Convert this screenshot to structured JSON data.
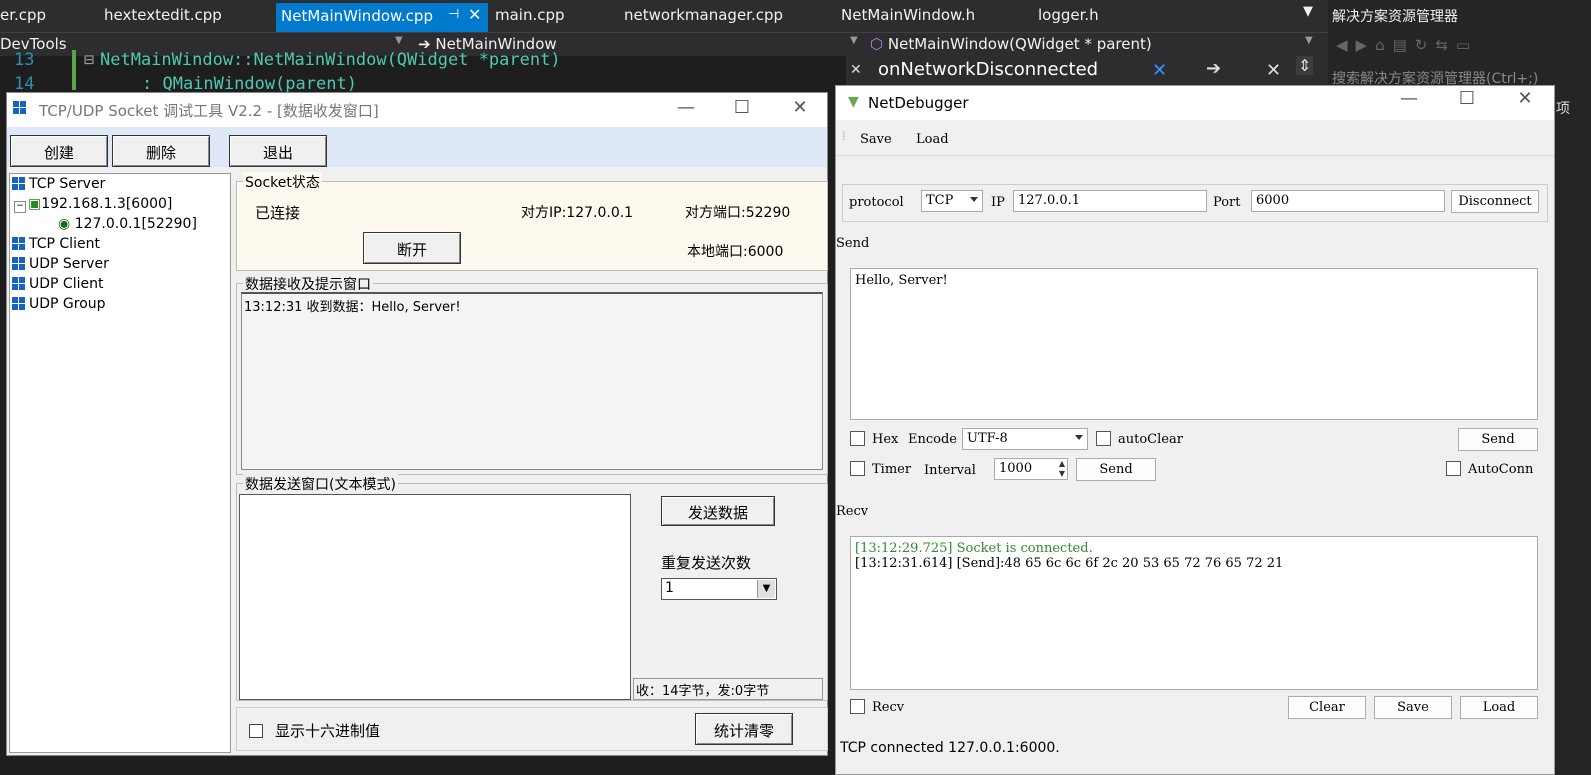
{
  "ide": {
    "tabs": [
      "er.cpp",
      "hextextedit.cpp",
      "main.cpp",
      "networkmanager.cpp",
      "NetMainWindow.h",
      "logger.h"
    ],
    "active_tab": "NetMainWindow.cpp",
    "nav_left": "DevTools",
    "nav_mid": "NetMainWindow",
    "nav_right": "NetMainWindow(QWidget * parent)",
    "code_line_13_no": "13",
    "code_line_13": "NetMainWindow::NetMainWindow(QWidget *parent)",
    "code_line_14_no": "14",
    "code_line_14": ": QMainWindow(parent)",
    "find_text": "onNetworkDisconnected",
    "right_title": "解决方案资源管理器",
    "right_search": "搜索解决方案资源管理器(Ctrl+;)",
    "right_partial": "项"
  },
  "tool": {
    "title": "TCP/UDP Socket 调试工具 V2.2 - [数据收发窗口]",
    "toolbar": {
      "create": "创建",
      "delete": "删除",
      "exit": "退出"
    },
    "tree": {
      "tcp_server": "TCP Server",
      "server_node": "192.168.1.3[6000]",
      "client_node": "127.0.0.1[52290]",
      "tcp_client": "TCP Client",
      "udp_server": "UDP Server",
      "udp_client": "UDP Client",
      "udp_group": "UDP Group"
    },
    "socket_status": {
      "legend": "Socket状态",
      "state": "已连接",
      "peer_ip": "对方IP:127.0.0.1",
      "peer_port": "对方端口:52290",
      "local_port": "本地端口:6000",
      "disconnect_button": "断开"
    },
    "recv_box": {
      "legend": "数据接收及提示窗口",
      "content": "13:12:31 收到数据：Hello, Server!"
    },
    "send_box": {
      "legend": "数据发送窗口(文本模式)",
      "content": "",
      "send_button": "发送数据",
      "repeat_label": "重复发送次数",
      "repeat_value": "1",
      "stats": "收：14字节，发:0字节"
    },
    "hex_label": "显示十六进制值",
    "clear_stats_button": "统计清零"
  },
  "netdebugger": {
    "title": "NetDebugger",
    "menu": {
      "save": "Save",
      "load": "Load"
    },
    "protocol_label": "protocol",
    "protocol_value": "TCP",
    "ip_label": "IP",
    "ip_value": "127.0.0.1",
    "port_label": "Port",
    "port_value": "6000",
    "disconnect_button": "Disconnect",
    "send_label": "Send",
    "send_text": "Hello, Server!",
    "hex_label": "Hex",
    "encode_label": "Encode",
    "encode_value": "UTF-8",
    "autoclear_label": "autoClear",
    "send_button": "Send",
    "timer_label": "Timer",
    "interval_label": "Interval",
    "interval_value": "1000",
    "timer_send_button": "Send",
    "autoconn_label": "AutoConn",
    "recv_label": "Recv",
    "recv_lines": [
      {
        "text": "[13:12:29.725] Socket is connected.",
        "color": "#2e8b2e"
      },
      {
        "text": "[13:12:31.614] [Send]:48 65 6c 6c 6f 2c 20 53 65 72 76 65 72 21",
        "color": "#000000"
      }
    ],
    "recv_check_label": "Recv",
    "clear_button": "Clear",
    "save_button": "Save",
    "load_button": "Load",
    "status": "TCP connected 127.0.0.1:6000."
  }
}
